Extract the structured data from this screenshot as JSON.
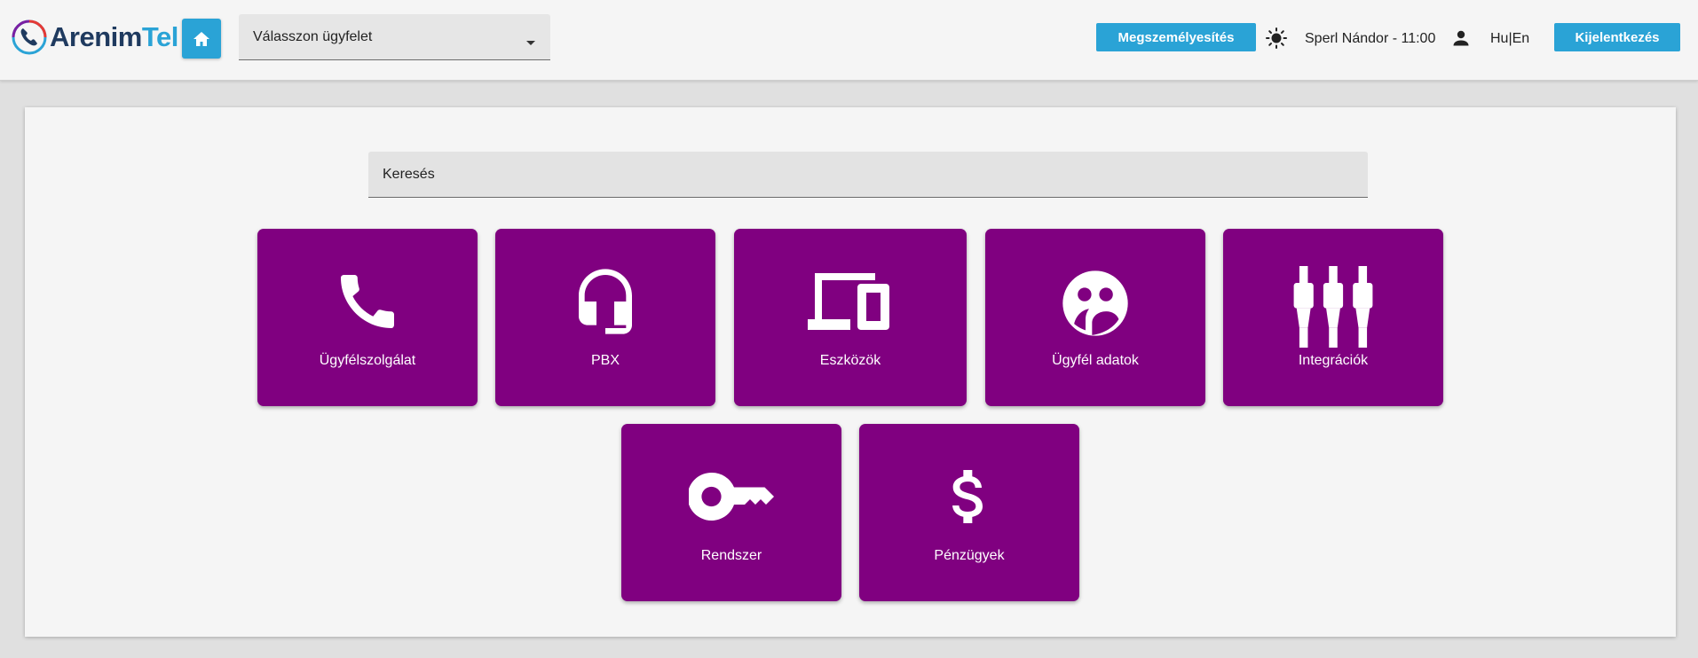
{
  "header": {
    "logo": {
      "part1": "Arenim",
      "part2": "Tel"
    },
    "client_select": {
      "value": "Válasszon ügyfelet"
    },
    "impersonate_label": "Megszemélyesítés",
    "user_info": "Sperl Nándor - 11:00",
    "language": "Hu|En",
    "logout_label": "Kijelentkezés"
  },
  "search": {
    "placeholder": "Keresés"
  },
  "tiles": [
    {
      "label": "Ügyfélszolgálat",
      "icon": "phone-icon"
    },
    {
      "label": "PBX",
      "icon": "headset-icon"
    },
    {
      "label": "Eszközök",
      "icon": "devices-icon"
    },
    {
      "label": "Ügyfél adatok",
      "icon": "customer-data-icon"
    },
    {
      "label": "Integrációk",
      "icon": "integration-plugs-icon"
    },
    {
      "label": "Rendszer",
      "icon": "key-icon"
    },
    {
      "label": "Pénzügyek",
      "icon": "dollar-icon"
    }
  ],
  "colors": {
    "tile": "#800080",
    "accent": "#2aa3d6",
    "logo_dark": "#1f3a5f"
  }
}
